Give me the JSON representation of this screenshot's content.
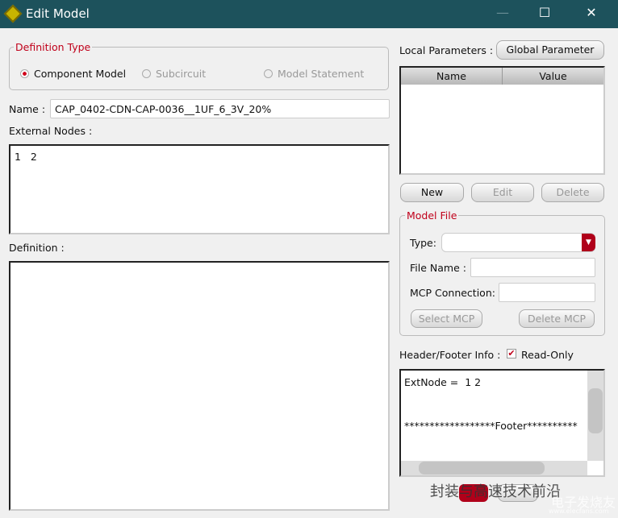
{
  "window": {
    "title": "Edit Model",
    "minimize": "—",
    "maximize": "☐",
    "close": "✕"
  },
  "definition_type": {
    "legend": "Definition Type",
    "options": [
      {
        "label": "Component Model",
        "selected": true,
        "enabled": true
      },
      {
        "label": "Subcircuit",
        "selected": false,
        "enabled": false
      },
      {
        "label": "Model Statement",
        "selected": false,
        "enabled": false
      }
    ]
  },
  "name": {
    "label": "Name :",
    "value": "CAP_0402-CDN-CAP-0036__1UF_6_3V_20%"
  },
  "external_nodes": {
    "label": "External Nodes :",
    "value": "1   2"
  },
  "definition": {
    "label": "Definition :",
    "value": ""
  },
  "local_parameters": {
    "label": "Local Parameters :",
    "global_button": "Global Parameter",
    "columns": [
      "Name",
      "Value"
    ],
    "new": "New",
    "edit": "Edit",
    "delete": "Delete"
  },
  "model_file": {
    "legend": "Model File",
    "type_label": "Type:",
    "type_value": "",
    "file_name_label": "File Name :",
    "file_name_value": "",
    "mcp_label": "MCP Connection:",
    "mcp_value": "",
    "select_mcp": "Select MCP",
    "delete_mcp": "Delete MCP"
  },
  "header_footer": {
    "label": "Header/Footer Info :",
    "readonly_label": "Read-Only",
    "readonly_checked": true,
    "line1": "ExtNode =  1 2",
    "line2": "******************Footer**********"
  },
  "watermark": {
    "text1": "封装与高速技术前沿",
    "text2": "电子发烧友",
    "url": "www.elecfans.com"
  }
}
